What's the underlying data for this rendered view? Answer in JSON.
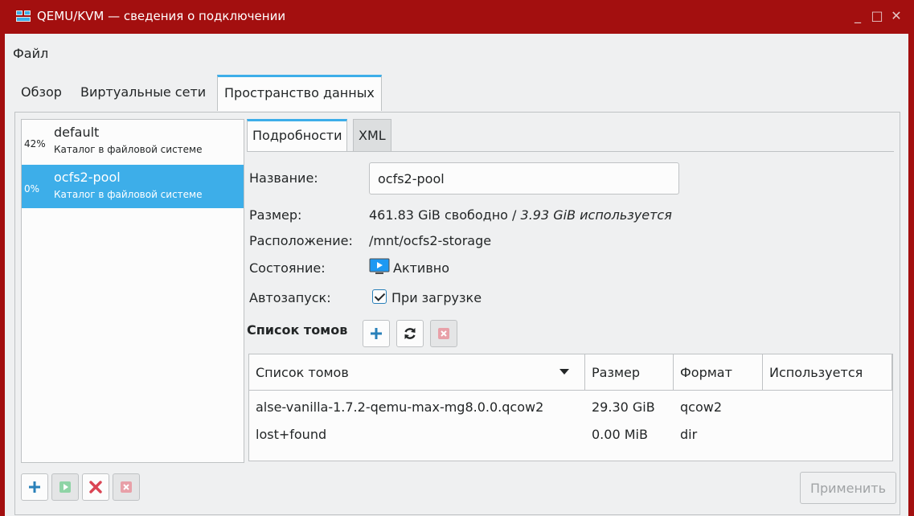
{
  "window": {
    "title": "QEMU/KVM — сведения о подключении",
    "minimize": "_",
    "maximize": "□",
    "close": "✕"
  },
  "menu": {
    "file": "Файл"
  },
  "tabs": [
    {
      "label": "Обзор"
    },
    {
      "label": "Виртуальные сети"
    },
    {
      "label": "Пространство данных"
    }
  ],
  "pools": [
    {
      "percent": "42%",
      "name": "default",
      "desc": "Каталог в файловой системе"
    },
    {
      "percent": "0%",
      "name": "ocfs2-pool",
      "desc": "Каталог в файловой системе"
    }
  ],
  "inner_tabs": [
    {
      "label": "Подробности"
    },
    {
      "label": "XML"
    }
  ],
  "details": {
    "name_label": "Название:",
    "name_value": "ocfs2-pool",
    "size_label": "Размер:",
    "size_free": "461.83 GiB свободно / ",
    "size_used": "3.93 GiB используется",
    "location_label": "Расположение:",
    "location_value": "/mnt/ocfs2-storage",
    "state_label": "Состояние:",
    "state_value": "Активно",
    "autostart_label": "Автозапуск:",
    "autostart_value": "При загрузке",
    "autostart_checked": true
  },
  "volumes": {
    "header": "Список томов",
    "columns": [
      "Список томов",
      "Размер",
      "Формат",
      "Используется"
    ],
    "rows": [
      {
        "name": "alse-vanilla-1.7.2-qemu-max-mg8.0.0.qcow2",
        "size": "29.30 GiB",
        "format": "qcow2",
        "used": ""
      },
      {
        "name": "lost+found",
        "size": "0.00 MiB",
        "format": "dir",
        "used": ""
      }
    ]
  },
  "apply_label": "Применить",
  "colors": {
    "accent": "#3daee9",
    "titlebar": "#a30f0f",
    "add": "#2980b9",
    "delete": "#da4453",
    "start": "#27ae60"
  }
}
